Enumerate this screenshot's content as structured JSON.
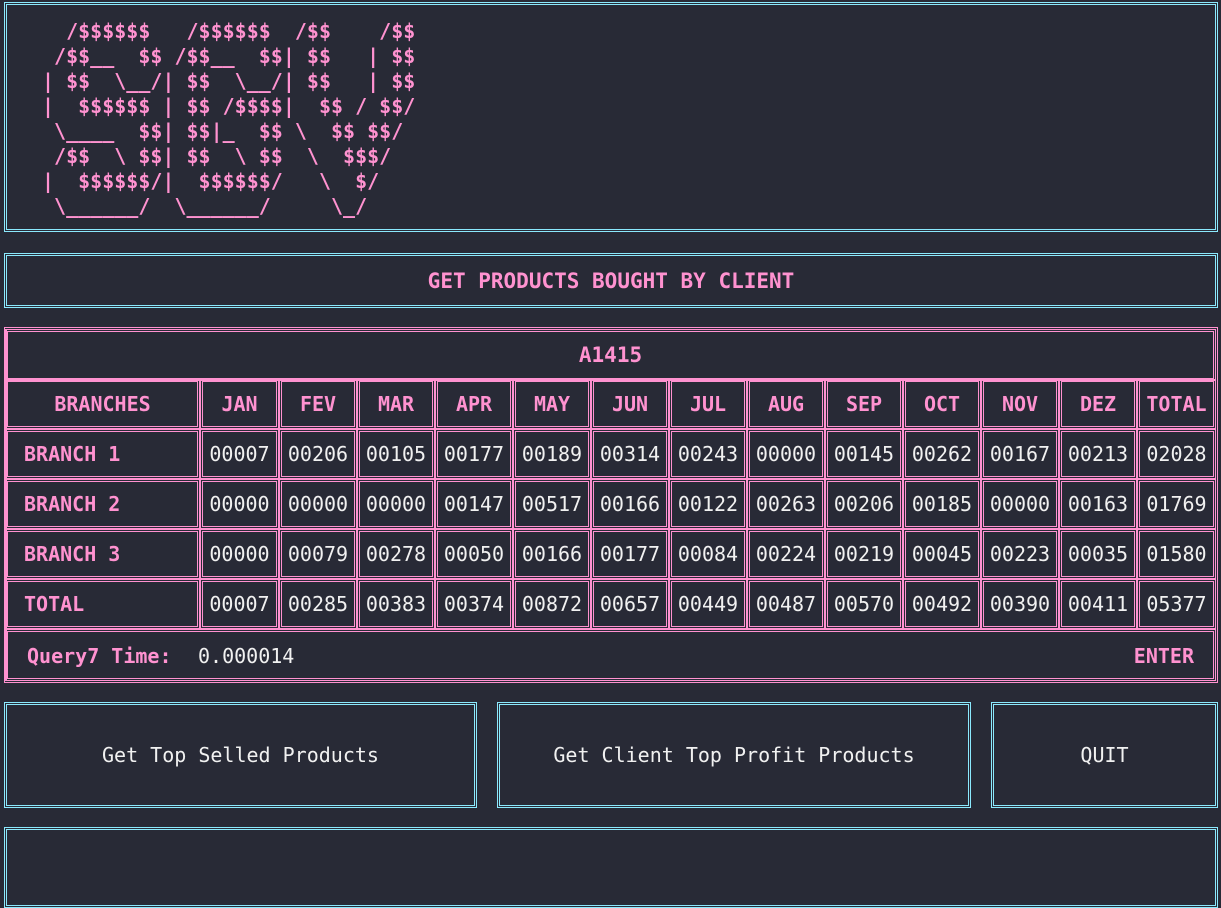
{
  "logo": {
    "lines": [
      "  /$$$$$$   /$$$$$$  /$$    /$$",
      " /$$__  $$ /$$__  $$| $$   | $$",
      "| $$  \\__/| $$  \\__/| $$   | $$",
      "|  $$$$$$ | $$ /$$$$|  $$ / $$/",
      " \\____  $$| $$|_  $$ \\  $$ $$/",
      " /$$  \\ $$| $$  \\ $$  \\  $$$/",
      "|  $$$$$$/|  $$$$$$/   \\  $/",
      " \\______/  \\______/     \\_/"
    ]
  },
  "title": "GET PRODUCTS BOUGHT BY CLIENT",
  "table": {
    "client_code": "A1415",
    "header": [
      "BRANCHES",
      "JAN",
      "FEV",
      "MAR",
      "APR",
      "MAY",
      "JUN",
      "JUL",
      "AUG",
      "SEP",
      "OCT",
      "NOV",
      "DEZ",
      "TOTAL"
    ],
    "rows": [
      [
        "BRANCH 1",
        "00007",
        "00206",
        "00105",
        "00177",
        "00189",
        "00314",
        "00243",
        "00000",
        "00145",
        "00262",
        "00167",
        "00213",
        "02028"
      ],
      [
        "BRANCH 2",
        "00000",
        "00000",
        "00000",
        "00147",
        "00517",
        "00166",
        "00122",
        "00263",
        "00206",
        "00185",
        "00000",
        "00163",
        "01769"
      ],
      [
        "BRANCH 3",
        "00000",
        "00079",
        "00278",
        "00050",
        "00166",
        "00177",
        "00084",
        "00224",
        "00219",
        "00045",
        "00223",
        "00035",
        "01580"
      ],
      [
        "TOTAL",
        "00007",
        "00285",
        "00383",
        "00374",
        "00872",
        "00657",
        "00449",
        "00487",
        "00570",
        "00492",
        "00390",
        "00411",
        "05377"
      ]
    ]
  },
  "footer": {
    "query_label": "Query7 Time:",
    "query_time": "0.000014",
    "enter_label": "ENTER"
  },
  "buttons": {
    "top_sold": "Get Top Selled Products",
    "top_profit": "Get Client Top Profit Products",
    "quit": "QUIT"
  },
  "colors": {
    "background": "#282a36",
    "accent_pink": "#ff92d0",
    "accent_cyan": "#8be9fd",
    "text": "#f1f1f1"
  }
}
